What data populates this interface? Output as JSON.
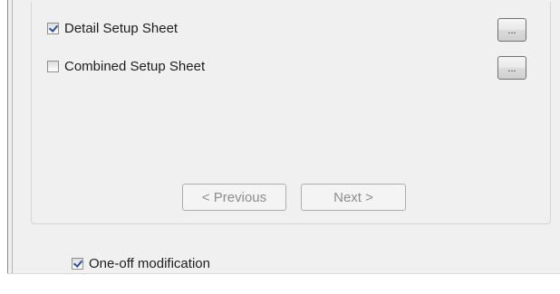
{
  "options": [
    {
      "label": "Detail Setup Sheet",
      "checked": true,
      "browse_label": "..."
    },
    {
      "label": "Combined Setup Sheet",
      "checked": false,
      "browse_label": "..."
    }
  ],
  "navigation": {
    "previous_label": "< Previous",
    "next_label": "Next >",
    "enabled": false
  },
  "one_off": {
    "label": "One-off modification",
    "checked": true
  }
}
